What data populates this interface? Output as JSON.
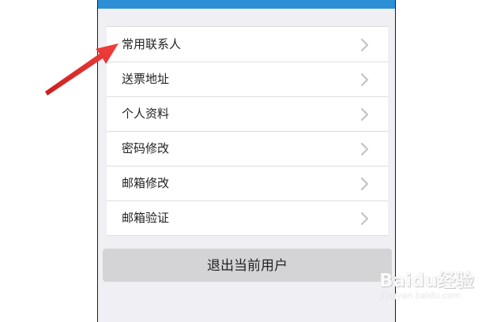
{
  "menu": {
    "items": [
      {
        "label": "常用联系人"
      },
      {
        "label": "送票地址"
      },
      {
        "label": "个人资料"
      },
      {
        "label": "密码修改"
      },
      {
        "label": "邮箱修改"
      },
      {
        "label": "邮箱验证"
      }
    ]
  },
  "logout": {
    "label": "退出当前用户"
  },
  "watermark": {
    "text": "Baidu经验",
    "sub": "jingyan.baidu.com"
  },
  "colors": {
    "topbar": "#2d8fd6",
    "background": "#efeff4",
    "annotation_arrow": "#e8312f"
  },
  "icons": {
    "row_chevron": "chevron-right-icon"
  }
}
